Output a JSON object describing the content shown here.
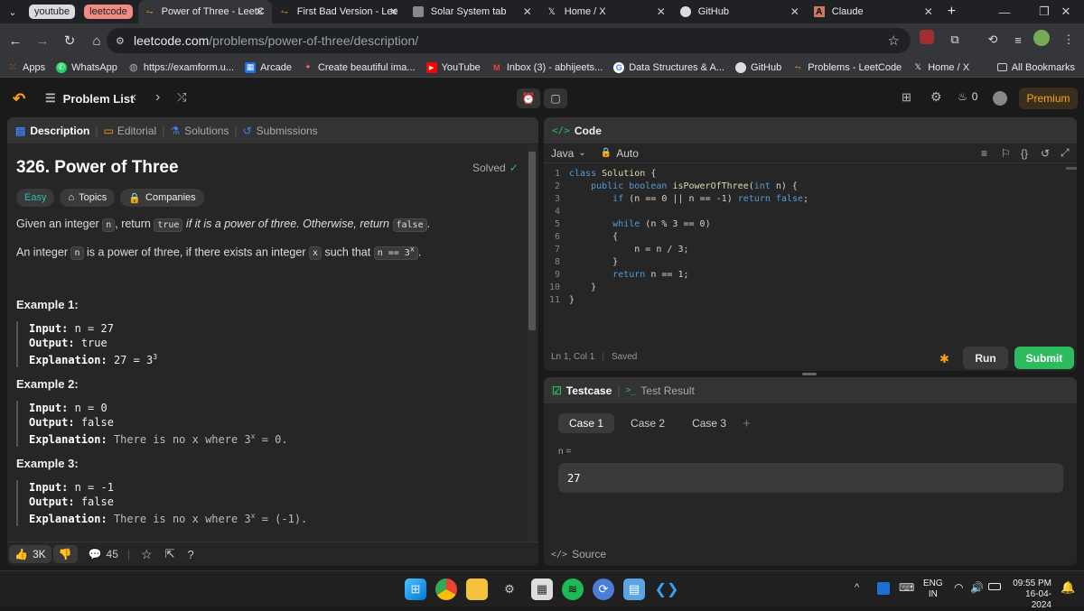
{
  "browser": {
    "tab_groups": [
      {
        "label": "youtube",
        "color": "#dadce0",
        "text": "#202124"
      },
      {
        "label": "leetcode",
        "color": "#f28b82",
        "text": "#202124"
      }
    ],
    "tabs": [
      {
        "title": "Power of Three - LeetC",
        "icon": "leetcode-icon"
      },
      {
        "title": "First Bad Version - Lee",
        "icon": "leetcode-icon"
      },
      {
        "title": "Solar System tab",
        "icon": "image-icon"
      },
      {
        "title": "Home / X",
        "icon": "x-icon"
      },
      {
        "title": "GitHub",
        "icon": "github-icon"
      },
      {
        "title": "Claude",
        "icon": "claude-icon"
      }
    ],
    "url_host": "leetcode.com",
    "url_path": "/problems/power-of-three/description/",
    "bookmarks": [
      {
        "label": "Apps",
        "icon": "apps-grid-icon"
      },
      {
        "label": "WhatsApp",
        "icon": "whatsapp-icon"
      },
      {
        "label": "https://examform.u...",
        "icon": "globe-icon"
      },
      {
        "label": "Arcade",
        "icon": "arcade-icon"
      },
      {
        "label": "Create beautiful ima...",
        "icon": "sparkle-icon"
      },
      {
        "label": "YouTube",
        "icon": "youtube-icon"
      },
      {
        "label": "Inbox (3) - abhijeets...",
        "icon": "gmail-icon"
      },
      {
        "label": "Data Structures & A...",
        "icon": "google-icon"
      },
      {
        "label": "GitHub",
        "icon": "github-icon"
      },
      {
        "label": "Problems - LeetCode",
        "icon": "leetcode-icon"
      },
      {
        "label": "Home / X",
        "icon": "x-icon"
      }
    ],
    "all_bookmarks": "All Bookmarks"
  },
  "lc": {
    "problem_list": "Problem List",
    "streak": "0",
    "premium": "Premium",
    "tabs": [
      "Description",
      "Editorial",
      "Solutions",
      "Submissions"
    ],
    "title": "326. Power of Three",
    "status": "Solved",
    "chips": [
      "Easy",
      "Topics",
      "Companies"
    ],
    "desc1_a": "Given an integer",
    "desc1_b": ", return",
    "desc1_c": "if it is a power of three. Otherwise, return",
    "desc2_a": "An integer",
    "desc2_b": "is a power of three, if there exists an integer",
    "desc2_c": "such that",
    "code_n": "n",
    "code_true": "true",
    "code_false": "false",
    "code_x": "x",
    "code_eq": "n == 3",
    "examples": [
      {
        "title": "Example 1:",
        "input": "n = 27",
        "output": "true",
        "explanation": "27 = 3",
        "exp": "3"
      },
      {
        "title": "Example 2:",
        "input": "n = 0",
        "output": "false",
        "explanation": "There is no x where 3",
        "exp": "x",
        "tail": " = 0."
      },
      {
        "title": "Example 3:",
        "input": "n = -1",
        "output": "false",
        "explanation": "There is no x where 3",
        "exp": "x",
        "tail": " = (-1)."
      }
    ],
    "labels": {
      "input": "Input:",
      "output": "Output:",
      "explanation": "Explanation:"
    },
    "likes": "3K",
    "comments": "45",
    "code_panel": "Code",
    "lang": "Java",
    "auto": "Auto",
    "status_line": "Ln 1, Col 1",
    "saved": "Saved",
    "run": "Run",
    "submit": "Submit",
    "testcase": "Testcase",
    "test_result": "Test Result",
    "cases": [
      "Case 1",
      "Case 2",
      "Case 3"
    ],
    "var_label": "n =",
    "var_value": "27",
    "source": "Source"
  },
  "code_lines": [
    "class Solution {",
    "    public boolean isPowerOfThree(int n) {",
    "        if (n == 0 || n == -1) return false;",
    "",
    "        while (n % 3 == 0)",
    "        {",
    "            n = n / 3;",
    "        }",
    "        return n == 1;",
    "    }",
    "}"
  ],
  "system": {
    "lang": "ENG",
    "region": "IN",
    "time": "09:55 PM",
    "date": "16-04-2024"
  },
  "colors": {
    "accent": "#ffa116",
    "green": "#2cbb5d",
    "easy": "#2cbbb8"
  }
}
